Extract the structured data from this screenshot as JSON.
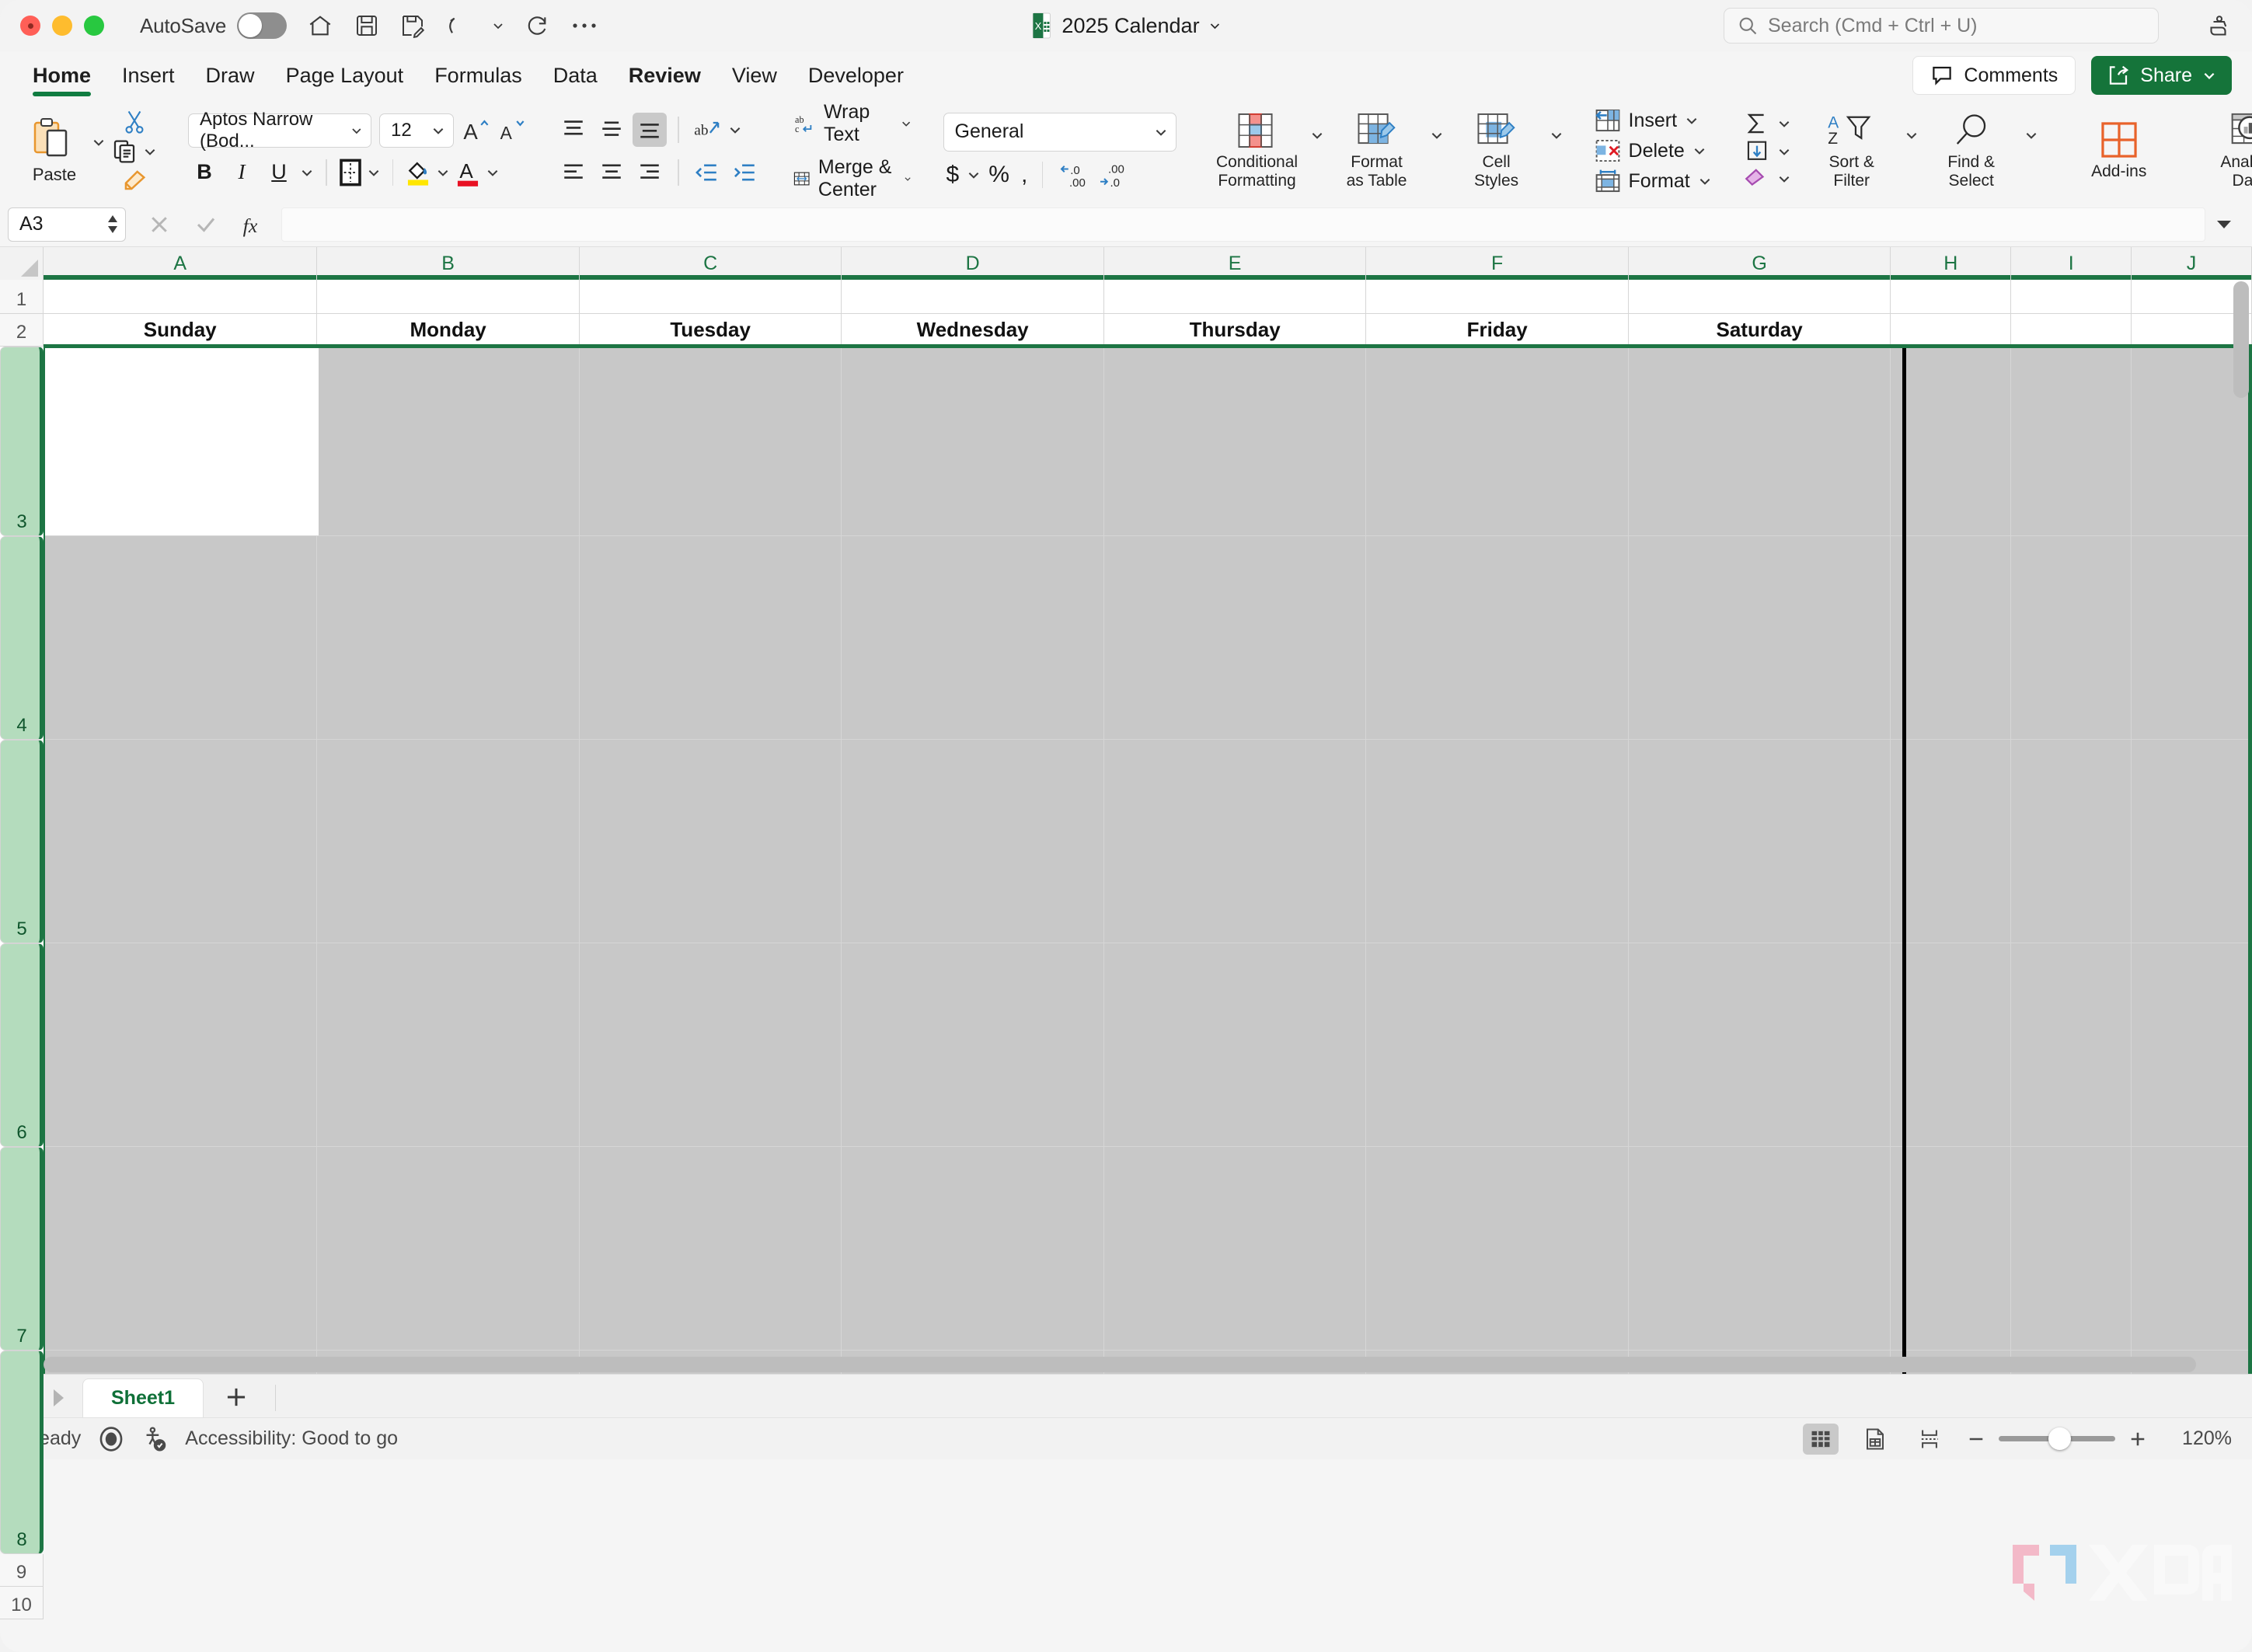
{
  "window": {
    "title": "2025 Calendar",
    "autosave_label": "AutoSave",
    "autosave_state": "off",
    "search_placeholder": "Search (Cmd + Ctrl + U)"
  },
  "ribbon_tabs": {
    "items": [
      {
        "label": "Home",
        "state": "active"
      },
      {
        "label": "Insert",
        "state": "normal"
      },
      {
        "label": "Draw",
        "state": "normal"
      },
      {
        "label": "Page Layout",
        "state": "normal"
      },
      {
        "label": "Formulas",
        "state": "normal"
      },
      {
        "label": "Data",
        "state": "normal"
      },
      {
        "label": "Review",
        "state": "hovered"
      },
      {
        "label": "View",
        "state": "normal"
      },
      {
        "label": "Developer",
        "state": "normal"
      }
    ],
    "comments_label": "Comments",
    "share_label": "Share"
  },
  "ribbon": {
    "clipboard": {
      "paste_label": "Paste"
    },
    "font": {
      "family": "Aptos Narrow (Bod...",
      "size": "12",
      "bold": "B",
      "italic": "I",
      "underline": "U"
    },
    "alignment": {
      "wrap_text": "Wrap Text",
      "merge_center": "Merge & Center"
    },
    "number": {
      "format": "General"
    },
    "styles": {
      "conditional_formatting_line1": "Conditional",
      "conditional_formatting_line2": "Formatting",
      "format_as_table_line1": "Format",
      "format_as_table_line2": "as Table",
      "cell_styles_line1": "Cell",
      "cell_styles_line2": "Styles"
    },
    "cells": {
      "insert": "Insert",
      "delete": "Delete",
      "format": "Format"
    },
    "editing": {
      "sort_filter_line1": "Sort &",
      "sort_filter_line2": "Filter",
      "find_select_line1": "Find &",
      "find_select_line2": "Select"
    },
    "addins": {
      "label": "Add-ins"
    },
    "analyze": {
      "line1": "Analyze",
      "line2": "Data"
    }
  },
  "formula_bar": {
    "name_box": "A3",
    "formula_value": ""
  },
  "grid": {
    "column_headers": [
      "A",
      "B",
      "C",
      "D",
      "E",
      "F",
      "G",
      "H",
      "I",
      "J"
    ],
    "row_headers": [
      "1",
      "2",
      "3",
      "4",
      "5",
      "6",
      "7",
      "8",
      "9",
      "10"
    ],
    "selected_columns": [
      "A",
      "B",
      "C",
      "D",
      "E",
      "F",
      "G",
      "H",
      "I",
      "J"
    ],
    "selected_rows": [
      "3",
      "4",
      "5",
      "6",
      "7",
      "8"
    ],
    "active_cell": "A3",
    "selection_range": "A3:J8",
    "day_headers": [
      "Sunday",
      "Monday",
      "Tuesday",
      "Wednesday",
      "Thursday",
      "Friday",
      "Saturday"
    ]
  },
  "sheet_tabs": {
    "tabs": [
      "Sheet1"
    ],
    "active": "Sheet1"
  },
  "status_bar": {
    "status": "Ready",
    "accessibility": "Accessibility: Good to go",
    "zoom": "120%"
  },
  "colors": {
    "excel_green": "#107c41",
    "grid_selection_green": "#1d7544",
    "row_header_selected": "#b4dcbd",
    "shaded_cell": "#c8c8c8",
    "share_button": "#15743a"
  },
  "watermark": {
    "text": "XDA"
  }
}
